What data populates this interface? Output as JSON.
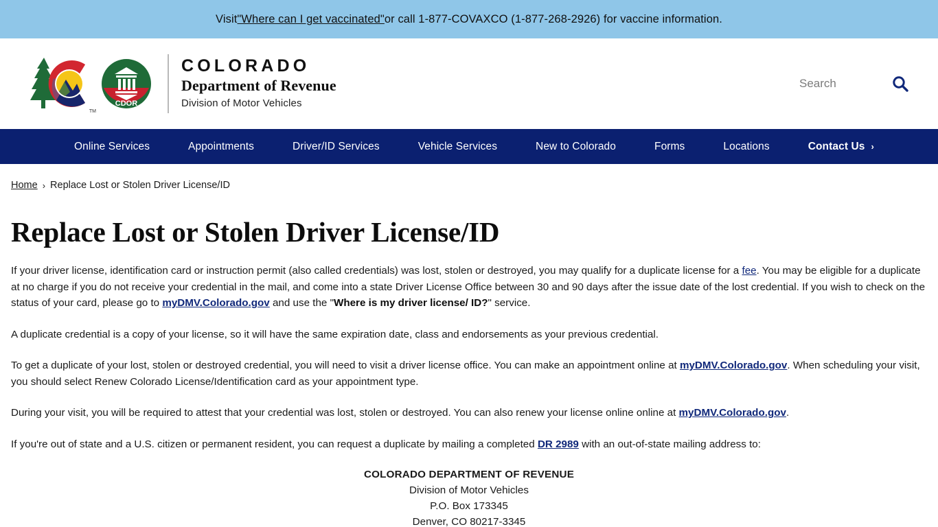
{
  "alert": {
    "prefix": "Visit ",
    "link_text": "\"Where can I get vaccinated\"",
    "suffix": " or call 1-877-COVAXCO (1-877-268-2926) for vaccine information.",
    "background_color": "#8fc6e8"
  },
  "header": {
    "logo_alt": "Colorado C logo",
    "badge_label": "CDOR",
    "agency_line1": "COLORADO",
    "agency_line2": "Department of Revenue",
    "agency_line3": "Division of Motor Vehicles",
    "search_placeholder": "Search",
    "search_value": "",
    "search_icon": "search-icon"
  },
  "nav": {
    "background_color": "#0b2070",
    "items": [
      {
        "label": "Online Services",
        "emphasis": false,
        "chevron": ""
      },
      {
        "label": "Appointments",
        "emphasis": false,
        "chevron": ""
      },
      {
        "label": "Driver/ID Services",
        "emphasis": false,
        "chevron": ""
      },
      {
        "label": "Vehicle Services",
        "emphasis": false,
        "chevron": ""
      },
      {
        "label": "New to Colorado",
        "emphasis": false,
        "chevron": ""
      },
      {
        "label": "Forms",
        "emphasis": false,
        "chevron": ""
      },
      {
        "label": "Locations",
        "emphasis": false,
        "chevron": ""
      },
      {
        "label": "Contact Us",
        "emphasis": true,
        "chevron": "›"
      }
    ]
  },
  "breadcrumb": {
    "home_label": "Home",
    "separator": "›",
    "current_label": "Replace Lost or Stolen Driver License/ID"
  },
  "main": {
    "title": "Replace Lost or Stolen Driver License/ID",
    "p1_a": "If your driver license, identification card or instruction permit (also called credentials) was lost, stolen or destroyed, you may qualify for a duplicate license for a ",
    "p1_fee_link": "fee",
    "p1_b": ". You may be eligible for a duplicate at no charge if you do not receive your credential in the mail, and come into a state Driver License Office between 30 and 90 days after the issue date of the lost credential. If you wish to check on the status of your card, please go to ",
    "p1_mydmv_link": "myDMV.Colorado.gov",
    "p1_c": " and use the \"",
    "p1_service_bold": "Where is my driver license/ ID?",
    "p1_d": "\" service.",
    "p2": "A duplicate credential is a copy of your license, so it will have the same expiration date, class and endorsements as your previous credential.",
    "p3_a": "To get a duplicate of your lost, stolen or destroyed credential, you will need to visit a driver license office. You can make an appointment online at ",
    "p3_mydmv_link": "myDMV.Colorado.gov",
    "p3_b": ". When scheduling your visit, you should select Renew Colorado License/Identification card as your appointment type.",
    "p4_a": "During your visit, you will be required to attest that your credential was lost, stolen or destroyed. You can also renew your license online online at ",
    "p4_mydmv_link": "myDMV.Colorado.gov",
    "p4_b": ".",
    "p5_a": "If you're out of state and a U.S. citizen or permanent resident, you can request a duplicate by mailing a completed ",
    "p5_form_link": "DR 2989",
    "p5_b": " with an out-of-state mailing address to:",
    "address": {
      "line1": "COLORADO DEPARTMENT OF REVENUE",
      "line2": "Division of Motor Vehicles",
      "line3": "P.O. Box 173345",
      "line4": "Denver, CO 80217-3345"
    }
  }
}
